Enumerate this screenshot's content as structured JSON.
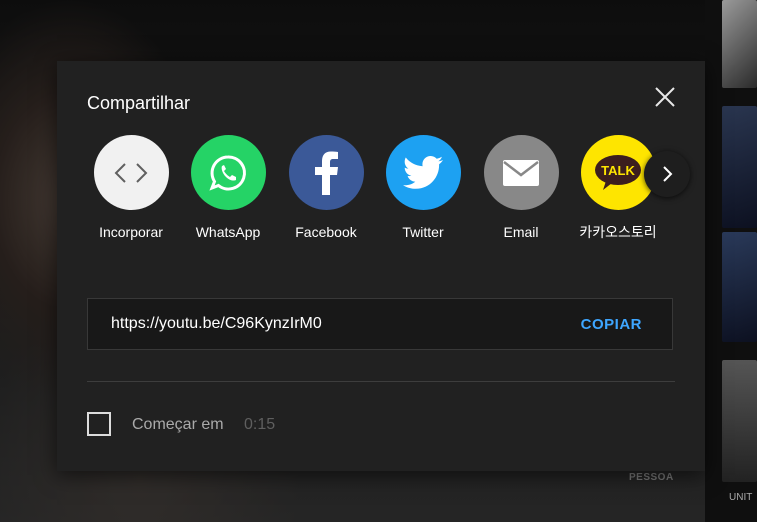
{
  "dialog": {
    "title": "Compartilhar",
    "close_icon": "close-icon",
    "share_options": [
      {
        "label": "Incorporar",
        "icon": "embed-code-icon",
        "color": "#f1f1f1"
      },
      {
        "label": "WhatsApp",
        "icon": "whatsapp-icon",
        "color": "#25d366"
      },
      {
        "label": "Facebook",
        "icon": "facebook-icon",
        "color": "#3b5998"
      },
      {
        "label": "Twitter",
        "icon": "twitter-icon",
        "color": "#1da1f2"
      },
      {
        "label": "Email",
        "icon": "email-icon",
        "color": "#888888"
      },
      {
        "label": "카카오스토리",
        "icon": "kakaotalk-icon",
        "color": "#fee500"
      }
    ],
    "next_icon": "chevron-right-icon",
    "url": "https://youtu.be/C96KynzIrM0",
    "copy_label": "COPIAR",
    "start_at_label": "Começar em",
    "start_at_time": "0:15",
    "accent_color": "#3ea6ff"
  },
  "background": {
    "video_text": "PESSOA",
    "sidebar_text": "UNIT"
  }
}
